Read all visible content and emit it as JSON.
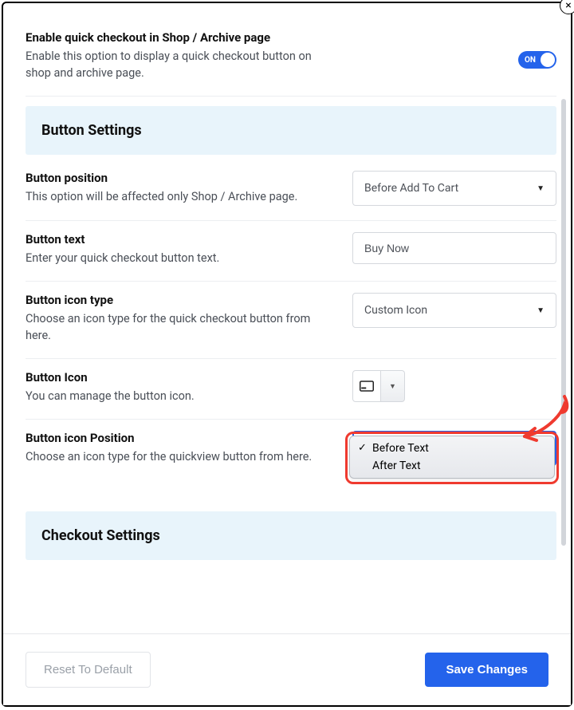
{
  "close_label": "×",
  "enable": {
    "title": "Enable quick checkout in Shop / Archive page",
    "desc": "Enable this option to display a quick checkout button on shop and archive page.",
    "toggle_label": "ON"
  },
  "banner1": {
    "title": "Button Settings"
  },
  "position": {
    "title": "Button position",
    "desc": "This option will be affected only Shop / Archive page.",
    "value": "Before Add To Cart"
  },
  "text": {
    "title": "Button text",
    "desc": "Enter your quick checkout button text.",
    "value": "Buy Now"
  },
  "icontype": {
    "title": "Button icon type",
    "desc": "Choose an icon type for the quick checkout button from here.",
    "value": "Custom Icon"
  },
  "icon": {
    "title": "Button Icon",
    "desc": "You can manage the button icon."
  },
  "iconpos": {
    "title": "Button icon Position",
    "desc": "Choose an icon type for the quickview button from here.",
    "options": [
      "Before Text",
      "After Text"
    ]
  },
  "banner2": {
    "title": "Checkout Settings"
  },
  "footer": {
    "reset": "Reset To Default",
    "save": "Save Changes"
  }
}
